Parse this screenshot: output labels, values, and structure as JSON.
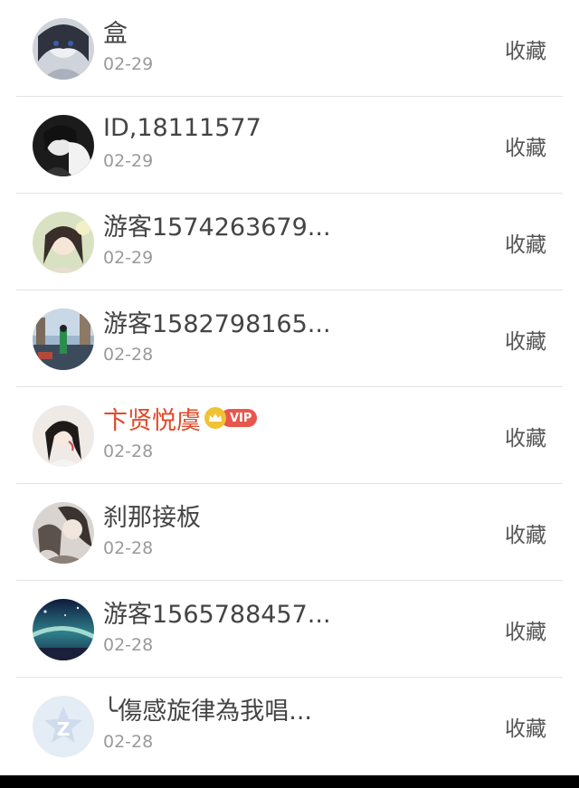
{
  "rows": [
    {
      "name": "盒",
      "date": "02-29",
      "action": "收藏",
      "avatar": "anime-girl-dark-avatar",
      "vip": false
    },
    {
      "name": "ID,18111577",
      "date": "02-29",
      "action": "收藏",
      "avatar": "bw-girl-avatar",
      "vip": false
    },
    {
      "name": "游客1574263679...",
      "date": "02-29",
      "action": "收藏",
      "avatar": "soft-girl-avatar",
      "vip": false
    },
    {
      "name": "游客1582798165...",
      "date": "02-28",
      "action": "收藏",
      "avatar": "street-scene-avatar",
      "vip": false
    },
    {
      "name": "卞贤悦虞",
      "date": "02-28",
      "action": "收藏",
      "avatar": "girl-portrait-avatar",
      "vip": true,
      "vip_label": "VIP"
    },
    {
      "name": "刹那接板",
      "date": "02-28",
      "action": "收藏",
      "avatar": "anime-couple-avatar",
      "vip": false
    },
    {
      "name": "游客1565788457...",
      "date": "02-28",
      "action": "收藏",
      "avatar": "night-sky-avatar",
      "vip": false
    },
    {
      "name": "╰傷感旋律為我唱...",
      "date": "02-28",
      "action": "收藏",
      "avatar": "default-qzone-avatar",
      "vip": false
    }
  ],
  "colors": {
    "name": "#444444",
    "vip_name": "#e04b2b",
    "date": "#9a9a9a",
    "action": "#555555",
    "divider": "#e3e3e3",
    "vip_badge": "#e8574d",
    "crown": "#f1c232",
    "default_avatar": "#e4ecf5"
  }
}
